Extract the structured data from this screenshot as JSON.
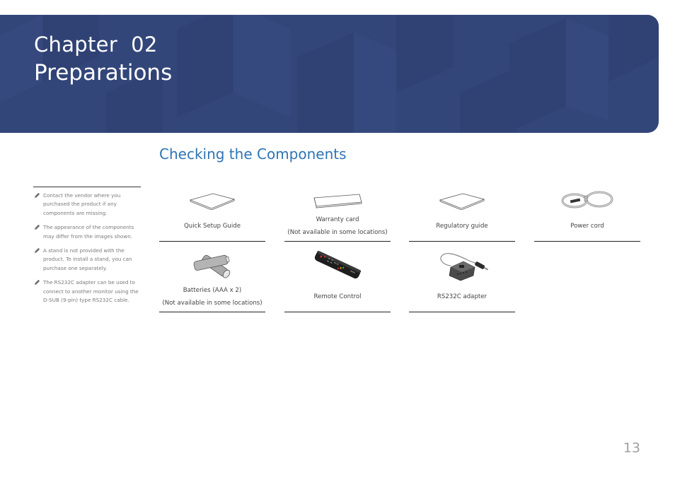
{
  "header": {
    "chapter_label": "Chapter  02",
    "chapter_title": "Preparations",
    "background_color": "#33467a"
  },
  "section": {
    "title": "Checking the Components",
    "title_color": "#2e74b5"
  },
  "notes": [
    {
      "icon": "pencil-note-icon",
      "text": "Contact the vendor where you purchased the product if any components are missing."
    },
    {
      "icon": "pencil-note-icon",
      "text": "The appearance of the components may differ from the images shown."
    },
    {
      "icon": "pencil-note-icon",
      "text": "A stand is not provided with the product. To install a stand, you can purchase one separately."
    },
    {
      "icon": "pencil-note-icon",
      "text": "The RS232C adapter can be used to connect to another monitor using the D-SUB (9-pin) type RS232C cable."
    }
  ],
  "components": [
    {
      "name": "Quick Setup Guide",
      "note": "",
      "image": "booklet-image"
    },
    {
      "name": "Warranty card",
      "note": "(Not available in some locations)",
      "image": "card-image"
    },
    {
      "name": "Regulatory guide",
      "note": "",
      "image": "booklet-image"
    },
    {
      "name": "Power cord",
      "note": "",
      "image": "power-cord-image"
    },
    {
      "name": "Batteries (AAA x 2)",
      "note": "(Not available in some locations)",
      "image": "batteries-image"
    },
    {
      "name": "Remote Control",
      "note": "",
      "image": "remote-control-image"
    },
    {
      "name": "RS232C adapter",
      "note": "",
      "image": "rs232c-adapter-image"
    }
  ],
  "footer": {
    "page_number": "13"
  }
}
